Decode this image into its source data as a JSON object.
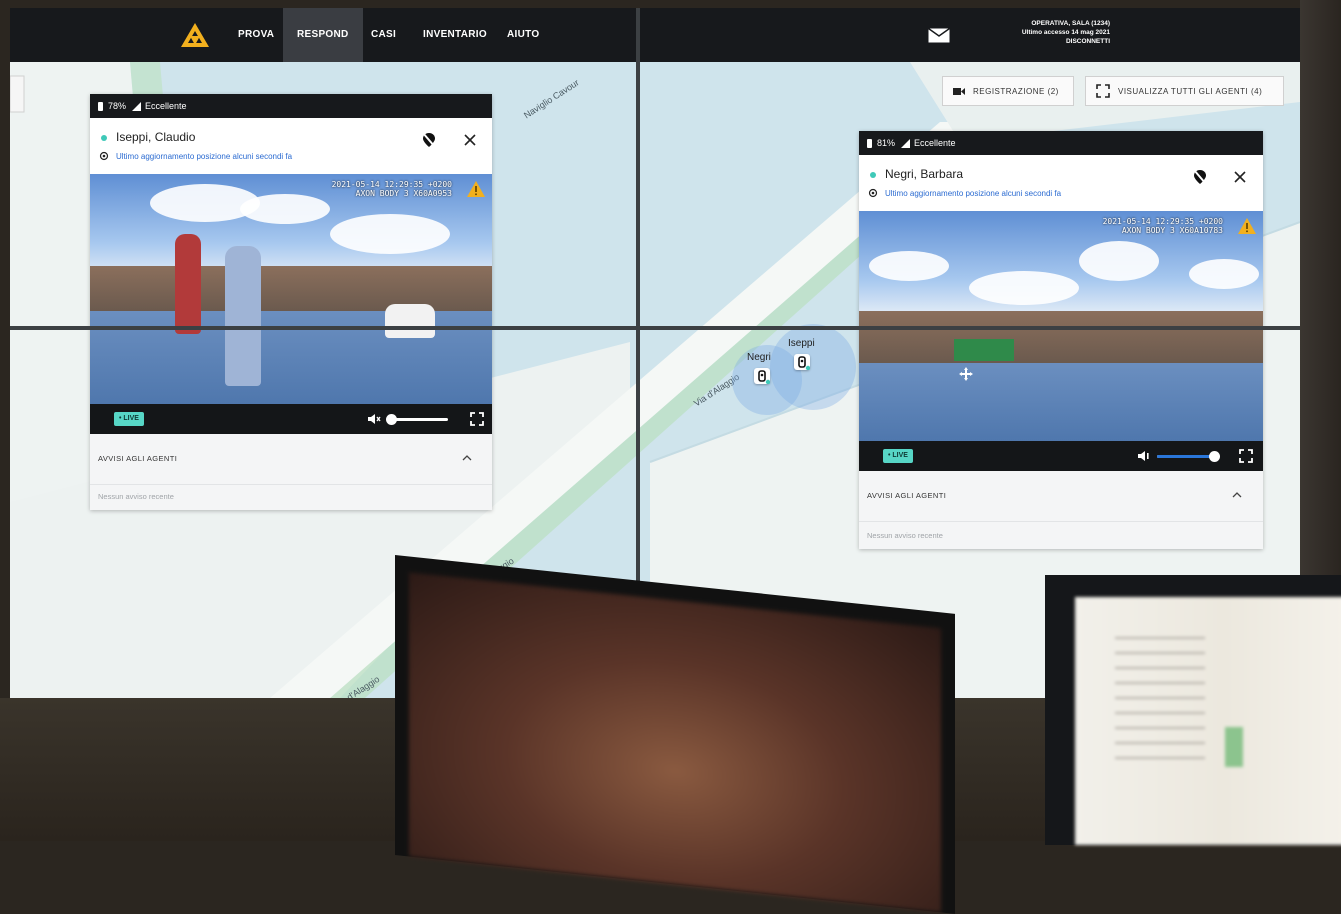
{
  "topbar": {
    "nav": [
      "PROVA",
      "RESPOND",
      "CASI",
      "INVENTARIO",
      "AIUTO"
    ],
    "active_nav": "RESPOND",
    "user": {
      "line1": "OPERATIVA, SALA (1234)",
      "line2": "Ultimo accesso 14 mag 2021",
      "line3": "DISCONNETTI"
    }
  },
  "map": {
    "buttons": {
      "recording": "REGISTRAZIONE (2)",
      "view_all": "VISUALIZZA TUTTI GLI AGENTI (4)"
    },
    "roads": [
      "Via d'Alaggio",
      "Alaggio",
      "d'Alaggio",
      "Naviglio Cavour"
    ],
    "markers": [
      {
        "label": "Negri"
      },
      {
        "label": "Iseppi"
      }
    ]
  },
  "panels": [
    {
      "battery": "78%",
      "signal": "Eccellente",
      "name": "Iseppi, Claudio",
      "update": "Ultimo aggiornamento posizione alcuni secondi fa",
      "overlay_line1": "2021-05-14 12:29:35 +0200",
      "overlay_line2": "AXON BODY 3 X60A0953",
      "live": "• LIVE",
      "muted": true,
      "volume": 0.0,
      "alerts_title": "AVVISI AGLI AGENTI",
      "alerts_empty": "Nessun avviso recente"
    },
    {
      "battery": "81%",
      "signal": "Eccellente",
      "name": "Negri, Barbara",
      "update": "Ultimo aggiornamento posizione alcuni secondi fa",
      "overlay_line1": "2021-05-14 12:29:35 +0200",
      "overlay_line2": "AXON BODY 3 X60A10783",
      "live": "• LIVE",
      "muted": false,
      "volume": 1.0,
      "alerts_title": "AVVISI AGLI AGENTI",
      "alerts_empty": "Nessun avviso recente"
    }
  ],
  "colors": {
    "accent": "#2a76d9",
    "live": "#57d6c6",
    "topbar": "#17191c",
    "logo": "#f2b01e"
  }
}
